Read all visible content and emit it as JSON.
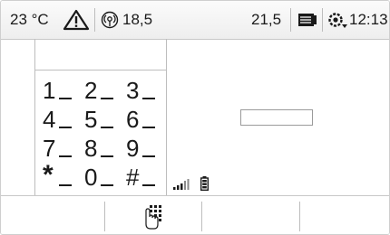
{
  "status_bar": {
    "outside_temp": "23 °C",
    "warning_icon": "warning-triangle-icon",
    "temp_left": "18,5",
    "temp_right": "21,5",
    "media_icon": "media-source-icon",
    "time": "12:13"
  },
  "keypad": {
    "rows": [
      [
        "1",
        "2",
        "3"
      ],
      [
        "4",
        "5",
        "6"
      ],
      [
        "7",
        "8",
        "9"
      ],
      [
        "*",
        "0",
        "#"
      ]
    ]
  },
  "bottom_bar": {
    "softkeys": [
      {
        "icon": ""
      },
      {
        "icon": "dial-pad-hand-icon"
      },
      {
        "icon": ""
      },
      {
        "icon": ""
      }
    ]
  }
}
